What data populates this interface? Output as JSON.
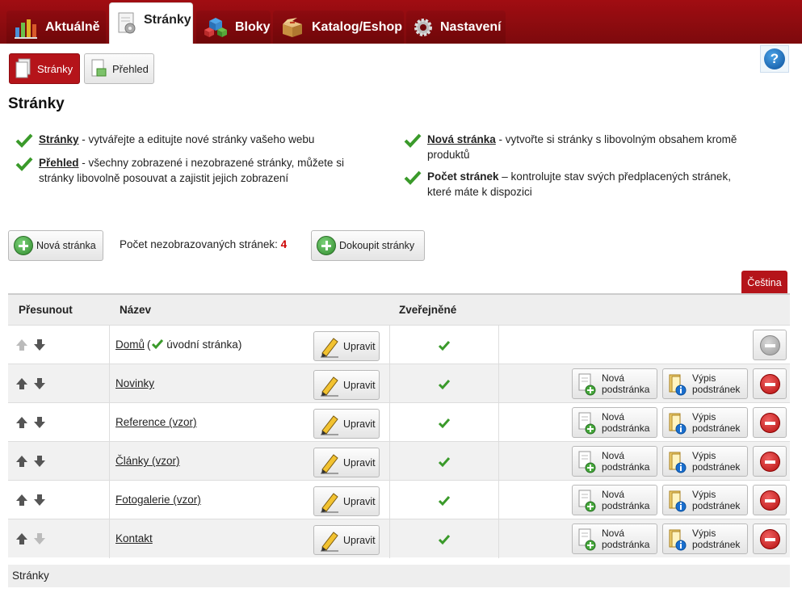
{
  "nav": {
    "tabs": [
      {
        "label": "Aktuálně",
        "icon": "chart-icon"
      },
      {
        "label": "Stránky",
        "icon": "page-gear-icon",
        "active": true
      },
      {
        "label": "Bloky",
        "icon": "blocks-icon"
      },
      {
        "label": "Katalog/Eshop",
        "icon": "box-icon"
      },
      {
        "label": "Nastavení",
        "icon": "gear-icon"
      }
    ],
    "accent_color": "#a10d12"
  },
  "subnav": {
    "pages_label": "Stránky",
    "overview_label": "Přehled"
  },
  "help_label": "?",
  "page_title": "Stránky",
  "features": {
    "left": [
      {
        "title": "Stránky",
        "desc": " - vytvářejte a editujte nové stránky vašeho webu"
      },
      {
        "title": "Přehled",
        "desc_line1": " - všechny zobrazené i nezobrazené stránky, můžete si",
        "desc_line2": "stránky libovolně posouvat a zajistit jejich zobrazení"
      }
    ],
    "right": [
      {
        "title": "Nová stránka",
        "desc_line1": " - vytvořte si stránky s libovolným obsahem kromě",
        "desc_line2": "produktů"
      },
      {
        "title": "Počet stránek",
        "desc_line1": " – kontrolujte stav svých předplacených stránek,",
        "desc_line2": "které máte k dispozici"
      }
    ]
  },
  "actions": {
    "new_page": "Nová stránka",
    "hidden_count_label": "Počet nezobrazovaných stránek:",
    "hidden_count": "4",
    "buy_pages": "Dokoupit stránky"
  },
  "language_tab": "Čeština",
  "table": {
    "headers": {
      "move": "Přesunout",
      "name": "Název",
      "published": "Zveřejněné"
    },
    "edit_label": "Upravit",
    "new_sub_line1": "Nová",
    "new_sub_line2": "podstránka",
    "list_sub_line1": "Výpis",
    "list_sub_line2": "podstránek",
    "rows": [
      {
        "name": "Domů",
        "extra": "úvodní stránka)",
        "extra_open": " (",
        "home": true
      },
      {
        "name": "Novinky"
      },
      {
        "name": "Reference (vzor)"
      },
      {
        "name": "Články (vzor)"
      },
      {
        "name": "Fotogalerie (vzor)"
      },
      {
        "name": "Kontakt"
      }
    ]
  },
  "footer": "Stránky"
}
